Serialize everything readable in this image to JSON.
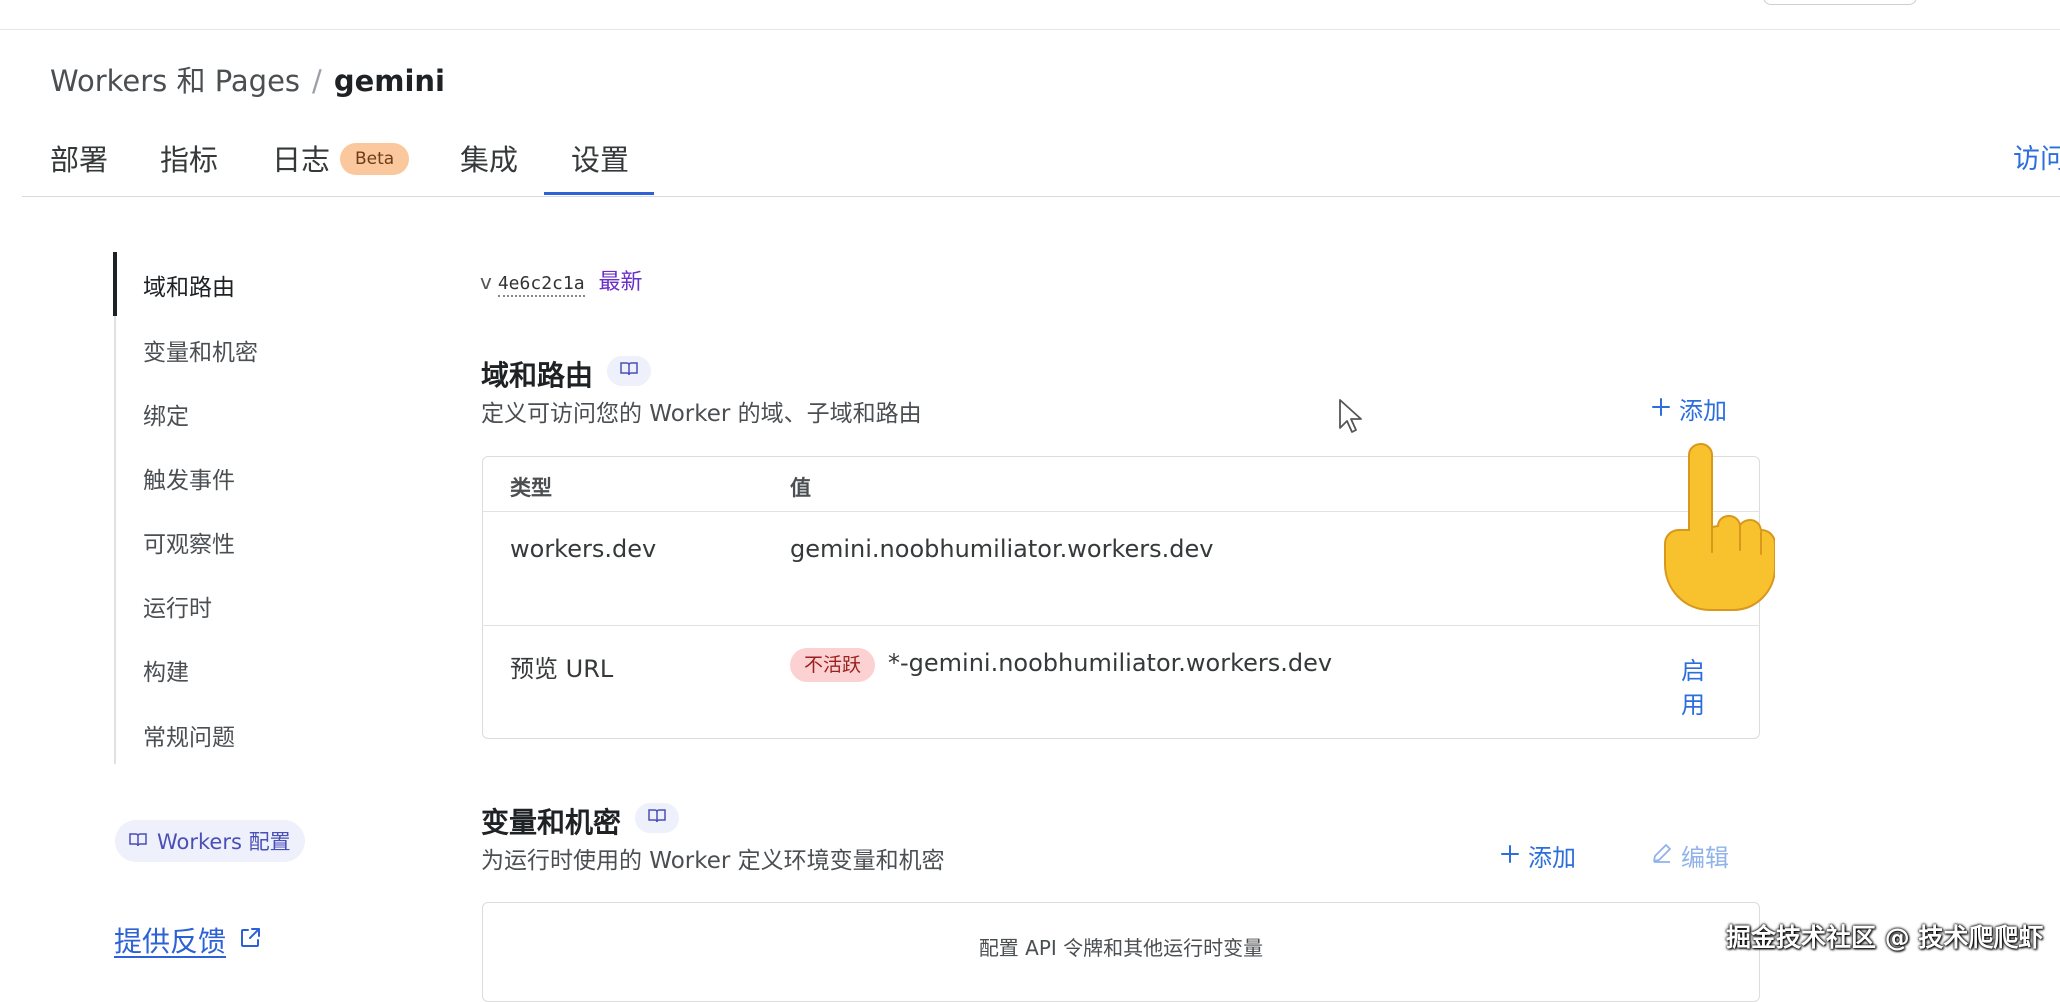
{
  "breadcrumb": {
    "parent": "Workers 和 Pages",
    "separator": "/",
    "current": "gemini"
  },
  "tabs": [
    {
      "label": "部署"
    },
    {
      "label": "指标"
    },
    {
      "label": "日志",
      "badge": "Beta"
    },
    {
      "label": "集成"
    },
    {
      "label": "设置",
      "active": true
    }
  ],
  "visit_label": "访问",
  "sidebar": {
    "items": [
      {
        "label": "域和路由",
        "active": true
      },
      {
        "label": "变量和机密"
      },
      {
        "label": "绑定"
      },
      {
        "label": "触发事件"
      },
      {
        "label": "可观察性"
      },
      {
        "label": "运行时"
      },
      {
        "label": "构建"
      },
      {
        "label": "常规问题"
      }
    ],
    "docs_pill": "Workers 配置",
    "feedback": "提供反馈"
  },
  "version": {
    "prefix": "v",
    "hash": "4e6c2c1a",
    "latest_label": "最新"
  },
  "domains": {
    "title": "域和路由",
    "description": "定义可访问您的 Worker 的域、子域和路由",
    "add_label": "添加",
    "columns": {
      "type": "类型",
      "value": "值"
    },
    "rows": [
      {
        "type": "workers.dev",
        "value": "gemini.noobhumiliator.workers.dev",
        "action": "用"
      },
      {
        "type": "预览 URL",
        "status": "不活跃",
        "value": "*-gemini.noobhumiliator.workers.dev",
        "action": "启用"
      }
    ]
  },
  "variables": {
    "title": "变量和机密",
    "description": "为运行时使用的 Worker 定义环境变量和机密",
    "add_label": "添加",
    "edit_label": "编辑",
    "config_text": "配置 API 令牌和其他运行时变量"
  },
  "watermark": "掘金技术社区 @ 技术爬爬虾",
  "colors": {
    "accent": "#2c6fdc",
    "tab_underline": "#2c62d6",
    "beta_bg": "#fbc79d",
    "inactive_bg": "#fcd1d1"
  },
  "icons": [
    "book-icon",
    "plus-icon",
    "pencil-icon",
    "external-link-icon",
    "pointing-hand-icon",
    "mouse-cursor-icon"
  ]
}
